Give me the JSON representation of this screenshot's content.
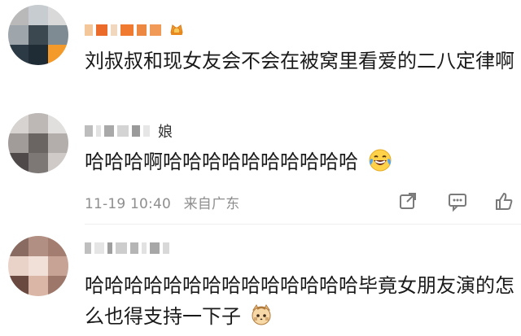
{
  "comments": [
    {
      "avatar_icon": "pixelated-avatar",
      "username_badge_icon": "vip-badge-icon",
      "text": "刘叔叔和现女友会不会在被窝里看爱的二八定律啊"
    },
    {
      "avatar_icon": "pixelated-avatar",
      "username_suffix": "娘",
      "text": "哈哈哈啊哈哈哈哈哈哈哈哈哈哈",
      "emoji": "laughing-tears-emoji",
      "meta": {
        "time": "11-19 10:40",
        "location": "来自广东"
      },
      "actions": [
        "share-icon",
        "comment-icon",
        "like-icon"
      ]
    },
    {
      "avatar_icon": "pixelated-avatar",
      "text": "哈哈哈哈哈哈哈哈哈哈哈哈哈哈毕竟女朋友演的怎么也得支持一下子",
      "emoji": "cat-emoji"
    }
  ],
  "colors": {
    "text": "#1a1a1a",
    "meta": "#8e8e8e",
    "icon": "#7a7a7a"
  }
}
